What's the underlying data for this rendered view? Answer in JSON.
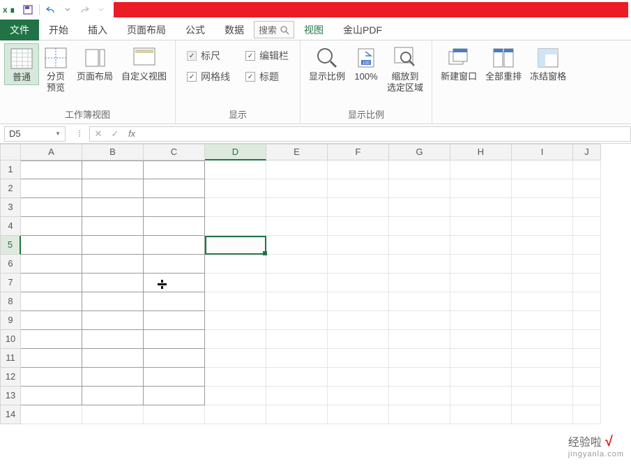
{
  "qat": {
    "app": "x ∎"
  },
  "tabs": {
    "file": "文件",
    "home": "开始",
    "insert": "插入",
    "layout": "页面布局",
    "formula": "公式",
    "data": "数据",
    "view": "视图",
    "jinshan": "金山PDF",
    "search": "搜索"
  },
  "ribbon": {
    "g1": {
      "label": "工作簿视图",
      "normal": "普通",
      "pagebreak": "分页\n预览",
      "pagelayout": "页面布局",
      "custom": "自定义视图"
    },
    "g2": {
      "label": "显示",
      "ruler": "标尺",
      "formulabar": "编辑栏",
      "gridlines": "网格线",
      "headings": "标题"
    },
    "g3": {
      "label": "显示比例",
      "zoom": "显示比例",
      "hundred": "100%",
      "zoomsel": "缩放到\n选定区域"
    },
    "g4": {
      "newwin": "新建窗口",
      "arrange": "全部重排",
      "freeze": "冻结窗格"
    }
  },
  "namebox": "D5",
  "columns": [
    "A",
    "B",
    "C",
    "D",
    "E",
    "F",
    "G",
    "H",
    "I",
    "J"
  ],
  "rows": [
    1,
    2,
    3,
    4,
    5,
    6,
    7,
    8,
    9,
    10,
    11,
    12,
    13,
    14
  ],
  "watermark": {
    "brand": "经验啦",
    "check": "√",
    "url": "jingyanla.com"
  }
}
